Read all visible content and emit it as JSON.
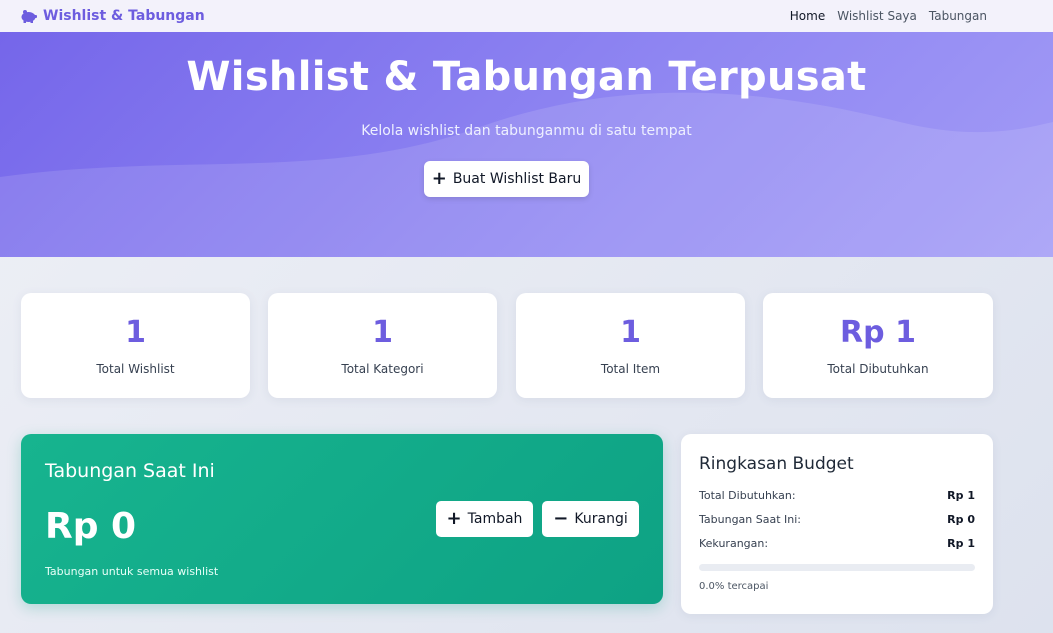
{
  "navbar": {
    "brand": "Wishlist & Tabungan",
    "brand_icon": "piggy-bank-icon",
    "links": [
      "Home",
      "Wishlist Saya",
      "Tabungan"
    ]
  },
  "hero": {
    "title": "Wishlist & Tabungan Terpusat",
    "subtitle": "Kelola wishlist dan tabunganmu di satu tempat",
    "button_label": "Buat Wishlist Baru",
    "button_icon": "plus-icon"
  },
  "stats": [
    {
      "value": "1",
      "label": "Total Wishlist"
    },
    {
      "value": "1",
      "label": "Total Kategori"
    },
    {
      "value": "1",
      "label": "Total Item"
    },
    {
      "value": "Rp 1",
      "label": "Total Dibutuhkan"
    }
  ],
  "savings": {
    "title": "Tabungan Saat Ini",
    "amount": "Rp 0",
    "note": "Tabungan untuk semua wishlist",
    "add_label": "Tambah",
    "subtract_label": "Kurangi"
  },
  "budget": {
    "title": "Ringkasan Budget",
    "rows": [
      {
        "label": "Total Dibutuhkan:",
        "value": "Rp 1"
      },
      {
        "label": "Tabungan Saat Ini:",
        "value": "Rp 0"
      },
      {
        "label": "Kekurangan:",
        "value": "Rp 1"
      }
    ],
    "progress": 0.0,
    "progress_text": "0.0% tercapai"
  },
  "colors": {
    "accent": "#6d5ddf",
    "hero_start": "#7566ea",
    "savings_green": "#17b48f"
  }
}
